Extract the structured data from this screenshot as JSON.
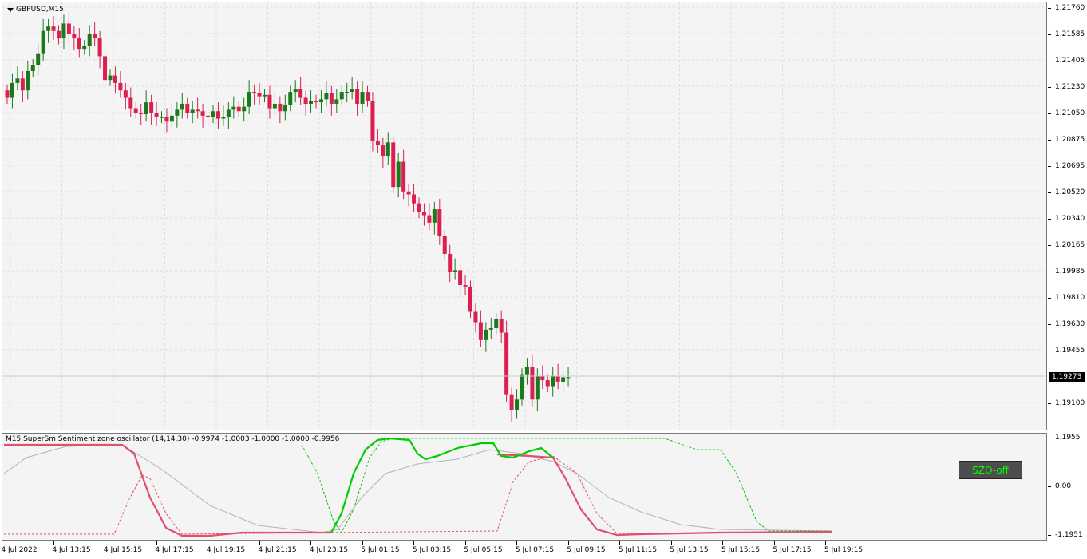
{
  "symbol": {
    "title": "GBPUSD,M15"
  },
  "price_axis": {
    "labels": [
      "1.21760",
      "1.21585",
      "1.21405",
      "1.21230",
      "1.21050",
      "1.20875",
      "1.20695",
      "1.20520",
      "1.20340",
      "1.20165",
      "1.19985",
      "1.19810",
      "1.19630",
      "1.19455",
      "1.19273",
      "1.19100"
    ],
    "current_price": "1.19273"
  },
  "oscillator": {
    "title": "M15 SuperSm Sentiment zone oscillator (14,14,30) -0.9974 -1.0003 -1.0000 -1.0000 -0.9956",
    "axis_labels": [
      "1.1955",
      "0.00",
      "-1.1951"
    ],
    "button_label": "SZO-off",
    "colors": {
      "bull": "#00cc00",
      "bear": "#e05070",
      "neutral": "#b4b4b4"
    }
  },
  "time_axis": {
    "labels": [
      "4 Jul 2022",
      "4 Jul 13:15",
      "4 Jul 15:15",
      "4 Jul 17:15",
      "4 Jul 19:15",
      "4 Jul 21:15",
      "4 Jul 23:15",
      "5 Jul 01:15",
      "5 Jul 03:15",
      "5 Jul 05:15",
      "5 Jul 07:15",
      "5 Jul 09:15",
      "5 Jul 11:15",
      "5 Jul 13:15",
      "5 Jul 15:15",
      "5 Jul 17:15",
      "5 Jul 19:15"
    ]
  },
  "colors": {
    "bull_candle": "#1a7a1a",
    "bear_candle": "#dc1e50",
    "grid": "#dcdce6"
  },
  "chart_data": {
    "type": "candlestick",
    "title": "GBPUSD,M15",
    "ylim": [
      1.1895,
      1.2178
    ],
    "close_series": [
      1.2115,
      1.2125,
      1.2128,
      1.212,
      1.2133,
      1.2137,
      1.2145,
      1.216,
      1.2163,
      1.216,
      1.2155,
      1.2165,
      1.2158,
      1.2155,
      1.2148,
      1.215,
      1.2158,
      1.2155,
      1.2143,
      1.2127,
      1.213,
      1.2125,
      1.212,
      1.2115,
      1.2108,
      1.2105,
      1.2104,
      1.2112,
      1.2105,
      1.2102,
      1.2102,
      1.2099,
      1.2103,
      1.2107,
      1.2111,
      1.2105,
      1.2107,
      1.2106,
      1.2103,
      1.2102,
      1.2106,
      1.2101,
      1.2102,
      1.2107,
      1.2109,
      1.2106,
      1.2109,
      1.2119,
      1.2118,
      1.2116,
      1.2117,
      1.2108,
      1.2111,
      1.2106,
      1.211,
      1.2119,
      1.2121,
      1.2115,
      1.2111,
      1.2113,
      1.2112,
      1.2114,
      1.2118,
      1.2111,
      1.2114,
      1.2119,
      1.2119,
      1.2121,
      1.2111,
      1.2119,
      1.2113,
      1.2086,
      1.2083,
      1.2076,
      1.2085,
      1.2055,
      1.2072,
      1.2052,
      1.205,
      1.2044,
      1.2038,
      1.2036,
      1.2031,
      1.204,
      1.2022,
      1.201,
      1.1998,
      1.1999,
      1.1989,
      1.1988,
      1.1971,
      1.1964,
      1.1952,
      1.1959,
      1.196,
      1.1966,
      1.1957,
      1.1915,
      1.1905,
      1.1912,
      1.1929,
      1.1934,
      1.1912,
      1.1928,
      1.1925,
      1.1921,
      1.1928,
      1.1924,
      1.1927,
      1.1927
    ]
  }
}
